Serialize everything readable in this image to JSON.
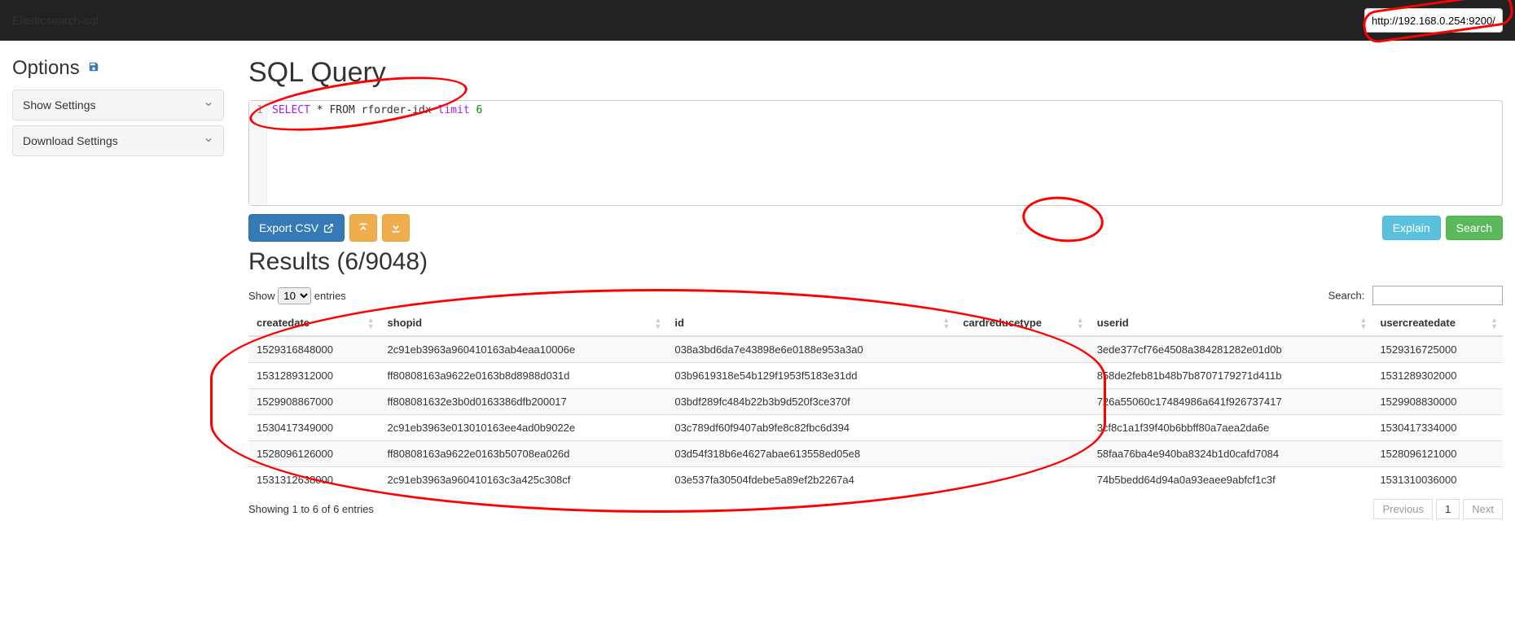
{
  "navbar": {
    "brand": "Elasticsearch-sql",
    "endpoint_value": "http://192.168.0.254:9200/"
  },
  "sidebar": {
    "options_title": "Options",
    "items": [
      "Show Settings",
      "Download Settings"
    ]
  },
  "main": {
    "title": "SQL Query",
    "editor": {
      "line_number": "1",
      "tokens": {
        "select": "SELECT",
        "star_from": " * FROM ",
        "table": "rforder-idx ",
        "limit": "limit",
        "space": " ",
        "n": "6"
      }
    },
    "toolbar": {
      "export_csv": "Export CSV",
      "explain": "Explain",
      "search": "Search"
    },
    "results_title": "Results (6/9048)",
    "results_shown": 6,
    "results_total": 9048,
    "datatable": {
      "show_label_pre": "Show",
      "show_label_post": "entries",
      "page_size_selected": "10",
      "search_label": "Search:",
      "columns": [
        "createdate",
        "shopid",
        "id",
        "cardreducetype",
        "userid",
        "usercreatedate"
      ],
      "rows": [
        [
          "1529316848000",
          "2c91eb3963a960410163ab4eaa10006e",
          "038a3bd6da7e43898e6e0188e953a3a0",
          "",
          "3ede377cf76e4508a384281282e01d0b",
          "1529316725000"
        ],
        [
          "1531289312000",
          "ff80808163a9622e0163b8d8988d031d",
          "03b9619318e54b129f1953f5183e31dd",
          "",
          "858de2feb81b48b7b8707179271d411b",
          "1531289302000"
        ],
        [
          "1529908867000",
          "ff808081632e3b0d0163386dfb200017",
          "03bdf289fc484b22b3b9d520f3ce370f",
          "",
          "726a55060c17484986a641f926737417",
          "1529908830000"
        ],
        [
          "1530417349000",
          "2c91eb3963e013010163ee4ad0b9022e",
          "03c789df60f9407ab9fe8c82fbc6d394",
          "",
          "3cf8c1a1f39f40b6bbff80a7aea2da6e",
          "1530417334000"
        ],
        [
          "1528096126000",
          "ff80808163a9622e0163b50708ea026d",
          "03d54f318b6e4627abae613558ed05e8",
          "",
          "58faa76ba4e940ba8324b1d0cafd7084",
          "1528096121000"
        ],
        [
          "1531312638000",
          "2c91eb3963a960410163c3a425c308cf",
          "03e537fa30504fdebe5a89ef2b2267a4",
          "",
          "74b5bedd64d94a0a93eaee9abfcf1c3f",
          "1531310036000"
        ]
      ],
      "info": "Showing 1 to 6 of 6 entries",
      "pager": {
        "prev": "Previous",
        "page": "1",
        "next": "Next"
      }
    }
  }
}
